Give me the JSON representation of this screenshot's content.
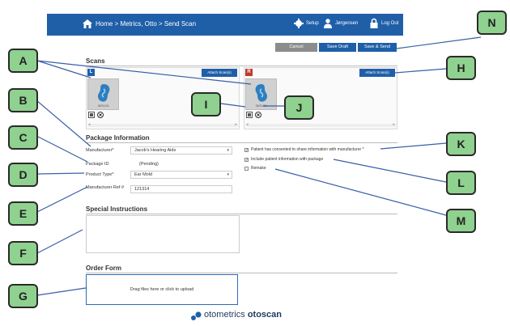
{
  "header": {
    "breadcrumb": "Home > Metrics, Otto > Send Scan",
    "setup_label": "Setup",
    "user_label": "Jørgensen",
    "logout_label": "Log Out",
    "background_color": "#1f5fa8"
  },
  "actions": {
    "cancel_label": "Cancel",
    "save_draft_label": "Save Draft",
    "save_send_label": "Save & Send"
  },
  "scans": {
    "title": "Scans",
    "left": {
      "badge": "L",
      "attach_label": "Attach Scan(s)",
      "scan_date": "08/31/15"
    },
    "right": {
      "badge": "R",
      "attach_label": "Attach Scan(s)",
      "scan_date": "08/31/15"
    }
  },
  "package": {
    "title": "Package Information",
    "manufacturer_label": "Manufacturer*",
    "manufacturer_value": "Jacob's Hearing Aids",
    "package_id_label": "Package ID",
    "package_id_value": "(Pending)",
    "product_type_label": "Product Type*",
    "product_type_value": "Ear Mold",
    "manufacturer_ref_label": "Manufacturer Ref #",
    "manufacturer_ref_value": "121314",
    "consent_label": "Patient has consented to share information with manufacturer *",
    "consent_checked": true,
    "include_patient_label": "Include patient information with package",
    "include_patient_checked": true,
    "remake_label": "Remake",
    "remake_checked": false
  },
  "special_instructions": {
    "title": "Special Instructions",
    "value": ""
  },
  "order_form": {
    "title": "Order Form",
    "dropzone_text": "Drag files here or click to upload"
  },
  "footer": {
    "logo_brand": "otometrics",
    "logo_product": "otoscan"
  },
  "callouts": [
    "A",
    "B",
    "C",
    "D",
    "E",
    "F",
    "G",
    "H",
    "I",
    "J",
    "K",
    "L",
    "M",
    "N"
  ],
  "colors": {
    "accent": "#1f5fa8",
    "callout_fill": "#8fd18f",
    "right_badge": "#c0392b"
  }
}
